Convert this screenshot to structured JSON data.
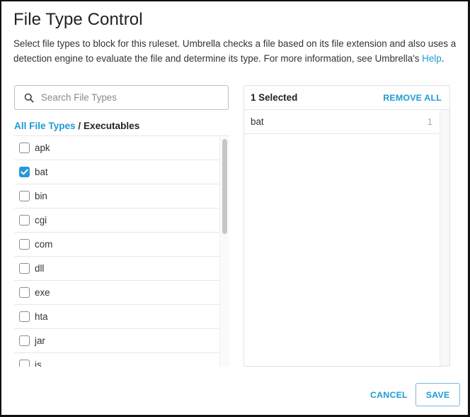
{
  "dialog": {
    "title": "File Type Control",
    "description_text": "Select file types to block for this ruleset. Umbrella checks a file based on its file extension and also uses a detection engine to evaluate the file and determine its type. For more information, see Umbrella's ",
    "help_link": "Help",
    "description_end": "."
  },
  "search": {
    "placeholder": "Search File Types",
    "value": "",
    "icon": "search-icon"
  },
  "breadcrumb": {
    "root": "All File Types",
    "separator": "/",
    "current": "Executables"
  },
  "file_types": [
    {
      "label": "apk",
      "checked": false
    },
    {
      "label": "bat",
      "checked": true
    },
    {
      "label": "bin",
      "checked": false
    },
    {
      "label": "cgi",
      "checked": false
    },
    {
      "label": "com",
      "checked": false
    },
    {
      "label": "dll",
      "checked": false
    },
    {
      "label": "exe",
      "checked": false
    },
    {
      "label": "hta",
      "checked": false
    },
    {
      "label": "jar",
      "checked": false
    },
    {
      "label": "js",
      "checked": false
    }
  ],
  "selected_panel": {
    "count_label": "1 Selected",
    "remove_all_label": "REMOVE ALL",
    "items": [
      {
        "label": "bat",
        "count": "1"
      }
    ]
  },
  "footer": {
    "cancel_label": "CANCEL",
    "save_label": "SAVE"
  },
  "colors": {
    "accent": "#1d9bd6",
    "checkbox_checked": "#2b98db"
  }
}
